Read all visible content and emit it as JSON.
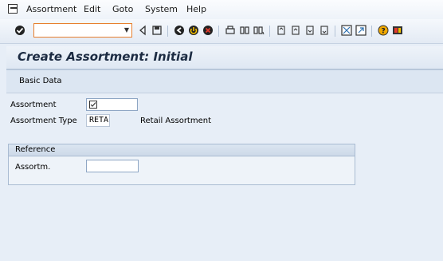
{
  "menu": {
    "items": [
      {
        "label": "Assortment"
      },
      {
        "label": "Edit"
      },
      {
        "label": "Goto"
      },
      {
        "label": "System"
      },
      {
        "label": "Help"
      }
    ]
  },
  "toolbar": {
    "command_field_value": "",
    "icons": [
      "enter-check-icon",
      "back-icon",
      "save-icon",
      "back-green-icon",
      "exit-icon",
      "cancel-icon",
      "print-icon",
      "find-icon",
      "find-next-icon",
      "first-page-icon",
      "previous-page-icon",
      "next-page-icon",
      "last-page-icon",
      "create-session-icon",
      "create-shortcut-icon",
      "help-icon",
      "layout-icon"
    ]
  },
  "title": "Create Assortment: Initial",
  "app_toolbar": {
    "basic_data_label": "Basic Data"
  },
  "form": {
    "assortment_label": "Assortment",
    "assortment_value": "",
    "assortment_type_label": "Assortment Type",
    "assortment_type_value": "RETA",
    "assortment_type_text": "Retail Assortment"
  },
  "reference": {
    "header": "Reference",
    "assortm_label": "Assortm.",
    "assortm_value": ""
  }
}
